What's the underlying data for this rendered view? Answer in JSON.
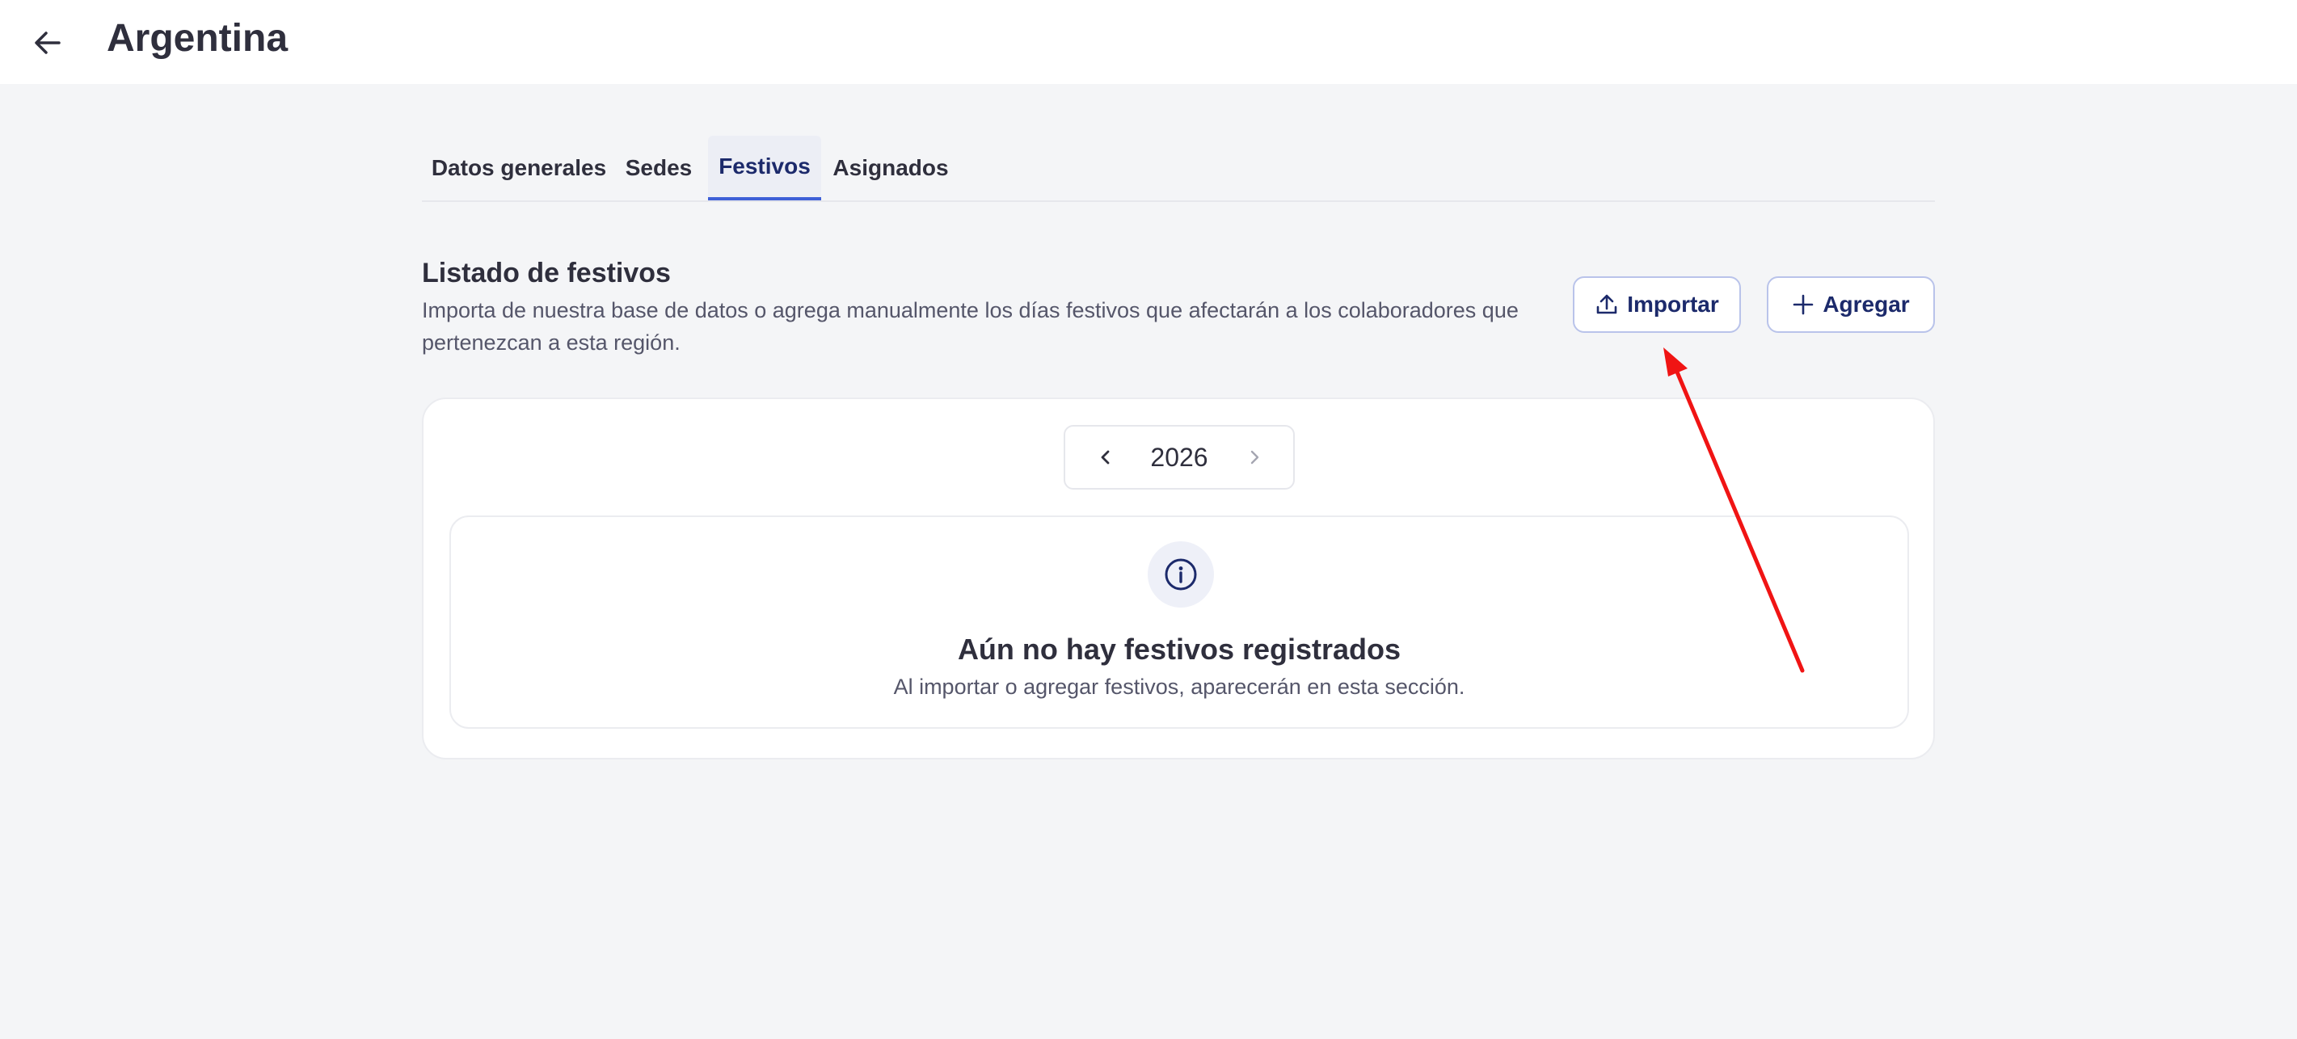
{
  "header": {
    "back_icon": "arrow-left-icon",
    "title": "Argentina"
  },
  "tabs": [
    {
      "label": "Datos generales",
      "active": false
    },
    {
      "label": "Sedes",
      "active": false
    },
    {
      "label": "Festivos",
      "active": true
    },
    {
      "label": "Asignados",
      "active": false
    }
  ],
  "section": {
    "title": "Listado de festivos",
    "description": "Importa de nuestra base de datos o agrega manualmente los días festivos que afectarán a los colaboradores que pertenezcan a esta región."
  },
  "actions": {
    "import_label": "Importar",
    "import_icon": "upload-icon",
    "add_label": "Agregar",
    "add_icon": "plus-icon"
  },
  "year_picker": {
    "value": "2026",
    "prev_icon": "chevron-left-icon",
    "next_icon": "chevron-right-icon"
  },
  "empty_state": {
    "icon": "info-icon",
    "title": "Aún no hay festivos registrados",
    "subtitle": "Al importar o agregar festivos, aparecerán en esta sección."
  },
  "colors": {
    "accent": "#1c2a6b",
    "tab_indicator": "#3d5fd7",
    "annotation_arrow": "#f01414"
  }
}
